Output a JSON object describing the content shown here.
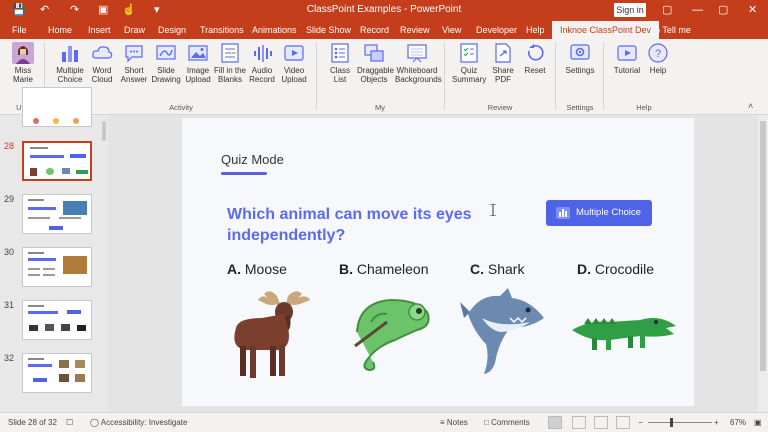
{
  "titlebar": {
    "doc_title": "ClassPoint Examples  -  PowerPoint",
    "signin_label": "Sign in",
    "qa_save": "💾",
    "qa_undo": "↶",
    "qa_redo": "↷",
    "qa_present": "▣",
    "qa_touch": "☝",
    "qa_more": "▾",
    "ribbon_display": "▢",
    "minimize": "—",
    "maximize": "▢",
    "close": "✕"
  },
  "tabs": [
    "File",
    "Home",
    "Insert",
    "Draw",
    "Design",
    "Transitions",
    "Animations",
    "Slide Show",
    "Record",
    "Review",
    "View",
    "Developer",
    "Help",
    "Inknoe ClassPoint Dev"
  ],
  "tellme": "Tell me",
  "ribbon": {
    "buttons": [
      {
        "label": "Miss Marie",
        "icon": "avatar-icon"
      },
      {
        "label": "Multiple Choice",
        "icon": "multiple-choice-icon"
      },
      {
        "label": "Word Cloud",
        "icon": "word-cloud-icon"
      },
      {
        "label": "Short Answer",
        "icon": "short-answer-icon"
      },
      {
        "label": "Slide Drawing",
        "icon": "slide-drawing-icon"
      },
      {
        "label": "Image Upload",
        "icon": "image-upload-icon"
      },
      {
        "label": "Fill in the Blanks",
        "icon": "fill-blanks-icon"
      },
      {
        "label": "Audio Record",
        "icon": "audio-record-icon"
      },
      {
        "label": "Video Upload",
        "icon": "video-upload-icon"
      },
      {
        "label": "Class List",
        "icon": "class-list-icon"
      },
      {
        "label": "Draggable Objects",
        "icon": "draggable-objects-icon"
      },
      {
        "label": "Whiteboard Backgrounds",
        "icon": "whiteboard-icon"
      },
      {
        "label": "Quiz Summary",
        "icon": "quiz-summary-icon"
      },
      {
        "label": "Share PDF",
        "icon": "share-pdf-icon"
      },
      {
        "label": "Reset",
        "icon": "reset-icon"
      },
      {
        "label": "Settings",
        "icon": "settings-icon"
      },
      {
        "label": "Tutorial",
        "icon": "tutorial-icon"
      },
      {
        "label": "Help",
        "icon": "help-icon"
      }
    ],
    "groups": [
      "User",
      "Activity",
      "My",
      "Review",
      "Settings",
      "Help"
    ],
    "collapse": "˄"
  },
  "thumbnails": [
    {
      "num": "28"
    },
    {
      "num": "29"
    },
    {
      "num": "30"
    },
    {
      "num": "31"
    },
    {
      "num": "32"
    }
  ],
  "slide": {
    "title": "Quiz Mode",
    "question": "Which animal can move its eyes independently?",
    "button_label": "Multiple Choice",
    "options": [
      {
        "letter": "A.",
        "text": "Moose"
      },
      {
        "letter": "B.",
        "text": "Chameleon"
      },
      {
        "letter": "C.",
        "text": "Shark"
      },
      {
        "letter": "D.",
        "text": "Crocodile"
      }
    ],
    "colors": {
      "accent": "#5b6af0",
      "button": "#4f63e8"
    }
  },
  "status": {
    "slide_counter": "Slide 28 of 32",
    "accessibility": "Accessibility: Investigate",
    "notes": "Notes",
    "comments": "Comments",
    "zoom": "67%"
  },
  "colors": {
    "brand": "#c43e1c"
  }
}
